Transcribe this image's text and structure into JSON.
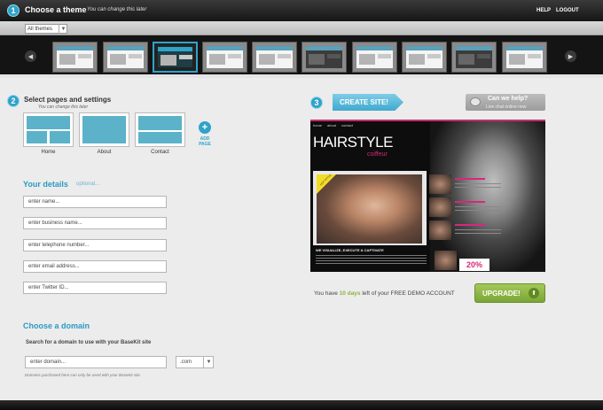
{
  "header": {
    "step": "1",
    "title": "Choose a theme",
    "hint": "You can change this later",
    "help": "HELP",
    "logout": "LOGOUT"
  },
  "filter": {
    "selected": "All themes",
    "arrow": "▼"
  },
  "carousel": {
    "prev": "◀",
    "next": "▶"
  },
  "pages": {
    "step": "2",
    "title": "Select pages and settings",
    "hint": "You can change this later",
    "items": [
      {
        "label": "Home"
      },
      {
        "label": "About"
      },
      {
        "label": "Contact"
      }
    ],
    "add_icon": "+",
    "add_label": "ADD PAGE"
  },
  "details": {
    "title": "Your details",
    "optional": "optional...",
    "fields": [
      {
        "placeholder": "enter name..."
      },
      {
        "placeholder": "enter business name..."
      },
      {
        "placeholder": "enter telephone number..."
      },
      {
        "placeholder": "enter email address..."
      },
      {
        "placeholder": "enter Twitter ID..."
      }
    ]
  },
  "domain": {
    "title": "Choose a domain",
    "subtitle": "Search for a domain to use with your BaseKit site",
    "placeholder": "enter domain...",
    "tld": ".com",
    "tld_arrow": "▼",
    "note": "Domains purchased here can only be used with your BaseKit site"
  },
  "create": {
    "step": "3",
    "button": "CREATE SITE!",
    "help_title": "Can we help?",
    "help_sub": "Live chat online now"
  },
  "preview": {
    "nav": [
      "home",
      "about",
      "contact"
    ],
    "title": "HAIRSTYLE",
    "subtitle": "coiffeur",
    "ribbon": "HOT STYLE",
    "tagline": "WE VISUALIZE, EXECUTE & CAPTIVATE",
    "badge": "20%"
  },
  "demo": {
    "prefix": "You have ",
    "days": "10 days",
    "suffix": " left of your FREE DEMO ACCOUNT",
    "upgrade": "UPGRADE!",
    "upgrade_icon": "⬆"
  },
  "colors": {
    "accent_blue": "#2fa3c9",
    "upgrade_green": "#8bb43c",
    "preview_pink": "#d6287a"
  }
}
